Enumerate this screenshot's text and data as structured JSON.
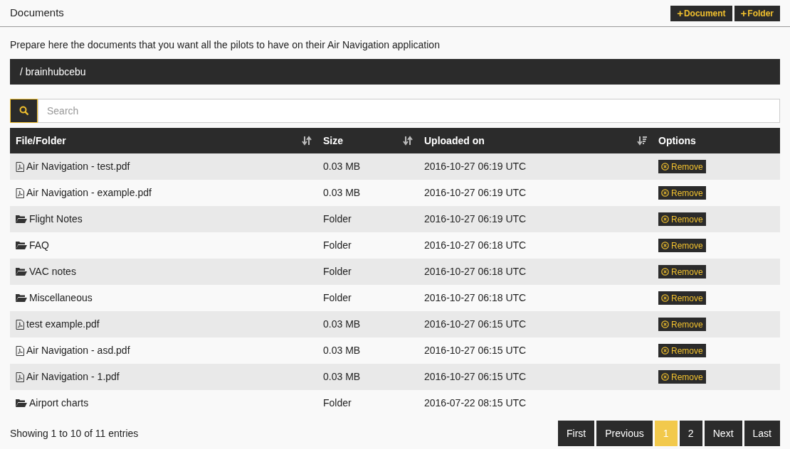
{
  "header": {
    "title": "Documents",
    "buttons": [
      {
        "icon": "+",
        "label": "Document"
      },
      {
        "icon": "+",
        "label": "Folder"
      }
    ]
  },
  "description": "Prepare here the documents that you want all the pilots to have on their Air Navigation application",
  "path": "/ brainhubcebu",
  "search": {
    "placeholder": "Search"
  },
  "table": {
    "columns": [
      {
        "label": "File/Folder",
        "sortable": true,
        "sorted": false
      },
      {
        "label": "Size",
        "sortable": true,
        "sorted": false
      },
      {
        "label": "Uploaded on",
        "sortable": true,
        "sorted": true
      },
      {
        "label": "Options",
        "sortable": false
      }
    ],
    "rows": [
      {
        "kind": "pdf",
        "name": "Air Navigation - test.pdf",
        "size": "0.03 MB",
        "uploaded": "2016-10-27 06:19 UTC",
        "action": "Remove"
      },
      {
        "kind": "pdf",
        "name": "Air Navigation - example.pdf",
        "size": "0.03 MB",
        "uploaded": "2016-10-27 06:19 UTC",
        "action": "Remove"
      },
      {
        "kind": "folder",
        "name": "Flight Notes",
        "size": "Folder",
        "uploaded": "2016-10-27 06:19 UTC",
        "action": "Remove"
      },
      {
        "kind": "folder",
        "name": "FAQ",
        "size": "Folder",
        "uploaded": "2016-10-27 06:18 UTC",
        "action": "Remove"
      },
      {
        "kind": "folder",
        "name": "VAC notes",
        "size": "Folder",
        "uploaded": "2016-10-27 06:18 UTC",
        "action": "Remove"
      },
      {
        "kind": "folder",
        "name": "Miscellaneous",
        "size": "Folder",
        "uploaded": "2016-10-27 06:18 UTC",
        "action": "Remove"
      },
      {
        "kind": "pdf",
        "name": "test example.pdf",
        "size": "0.03 MB",
        "uploaded": "2016-10-27 06:15 UTC",
        "action": "Remove"
      },
      {
        "kind": "pdf",
        "name": "Air Navigation - asd.pdf",
        "size": "0.03 MB",
        "uploaded": "2016-10-27 06:15 UTC",
        "action": "Remove"
      },
      {
        "kind": "pdf",
        "name": "Air Navigation - 1.pdf",
        "size": "0.03 MB",
        "uploaded": "2016-10-27 06:15 UTC",
        "action": "Remove"
      },
      {
        "kind": "folder",
        "name": "Airport charts",
        "size": "Folder",
        "uploaded": "2016-07-22 08:15 UTC"
      }
    ]
  },
  "footer": {
    "info": "Showing 1 to 10 of 11 entries",
    "pages": [
      {
        "label": "First",
        "selected": false
      },
      {
        "label": "Previous",
        "selected": false
      },
      {
        "label": "1",
        "selected": true
      },
      {
        "label": "2",
        "selected": false
      },
      {
        "label": "Next",
        "selected": false
      },
      {
        "label": "Last",
        "selected": false
      }
    ]
  }
}
